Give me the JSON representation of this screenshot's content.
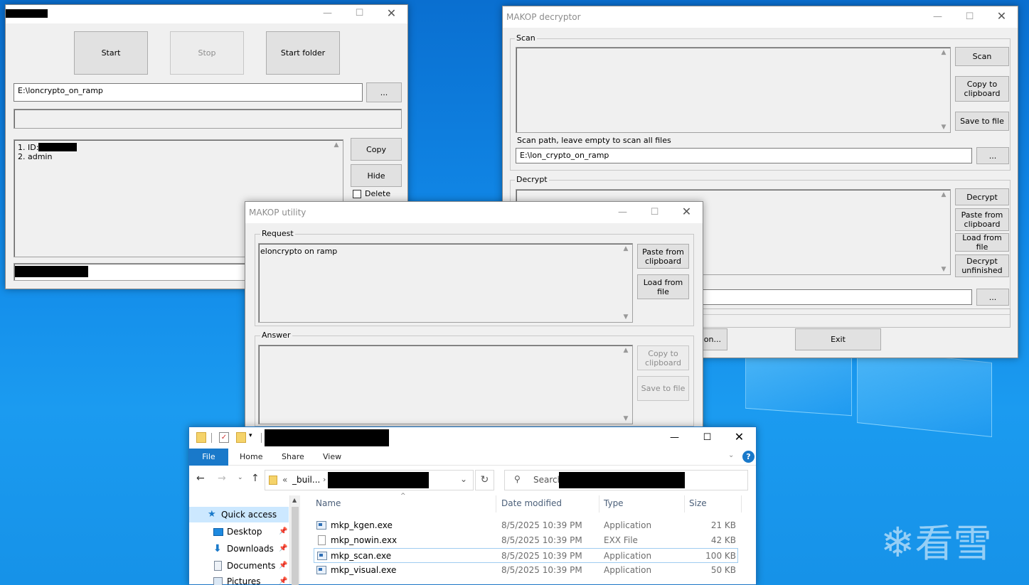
{
  "desktop": {
    "watermark_glyph": "❄",
    "watermark_text": "看雪"
  },
  "win_keygen": {
    "start_label": "Start",
    "stop_label": "Stop",
    "start_folder_label": "Start folder",
    "path_value": "E:\\loncrypto_on_ramp",
    "browse_label": "...",
    "list_line1": "1. ID:",
    "list_line2": "2. admin",
    "copy_label": "Copy",
    "hide_label": "Hide",
    "delete_label": "Delete"
  },
  "win_decryptor": {
    "title": "MAKOP decryptor",
    "scan_group": "Scan",
    "scan_label": "Scan",
    "copy_clip_label": "Copy to\nclipboard",
    "save_file_label": "Save to file",
    "scan_path_label": "Scan path, leave empty to scan all files",
    "scan_path_value": "E:\\lon_crypto_on_ramp",
    "browse_label": "...",
    "decrypt_group": "Decrypt",
    "decrypt_label": "Decrypt",
    "paste_clip_label": "Paste from\nclipboard",
    "load_file_label": "Load from file",
    "decrypt_unfinished_label": "Decrypt\nunfinished",
    "browse2_label": "...",
    "partial_button_label": "on...",
    "exit_label": "Exit"
  },
  "win_utility": {
    "title": "MAKOP utility",
    "request_group": "Request",
    "request_text": "eloncrypto on ramp",
    "paste_clip_label": "Paste from\nclipboard",
    "load_file_label": "Load from file",
    "answer_group": "Answer",
    "copy_clip_label": "Copy to\nclipboard",
    "save_file_label": "Save to file"
  },
  "explorer": {
    "tabs": {
      "file": "File",
      "home": "Home",
      "share": "Share",
      "view": "View"
    },
    "address_prefix": "«",
    "address_seg": "_buil...",
    "search_placeholder": "Search",
    "quick_access": [
      {
        "label": "Quick access"
      },
      {
        "label": "Desktop"
      },
      {
        "label": "Downloads"
      },
      {
        "label": "Documents"
      },
      {
        "label": "Pictures"
      }
    ],
    "columns": {
      "name": "Name",
      "date": "Date modified",
      "type": "Type",
      "size": "Size"
    },
    "files": [
      {
        "name": "mkp_kgen.exe",
        "date": "8/5/2025 10:39 PM",
        "type": "Application",
        "size": "21 KB"
      },
      {
        "name": "mkp_nowin.exx",
        "date": "8/5/2025 10:39 PM",
        "type": "EXX File",
        "size": "42 KB"
      },
      {
        "name": "mkp_scan.exe",
        "date": "8/5/2025 10:39 PM",
        "type": "Application",
        "size": "100 KB"
      },
      {
        "name": "mkp_visual.exe",
        "date": "8/5/2025 10:39 PM",
        "type": "Application",
        "size": "50 KB"
      }
    ]
  }
}
